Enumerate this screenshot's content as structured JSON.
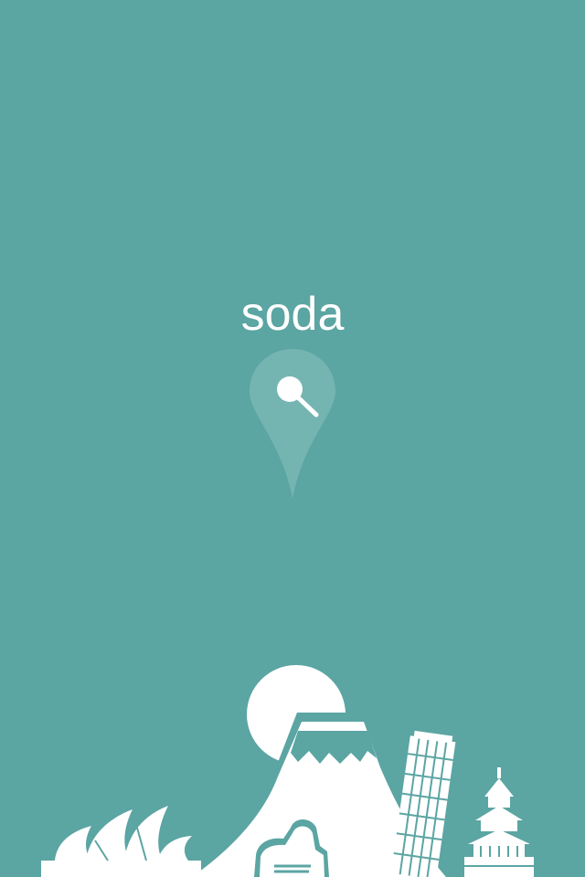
{
  "app": {
    "title": "soda"
  },
  "logo": {
    "pin_icon": "map-pin-icon",
    "search_icon": "search-icon"
  },
  "illustration": {
    "landmarks": [
      "sydney-opera-house-icon",
      "sun-icon",
      "mount-fuji-icon",
      "sphinx-icon",
      "leaning-tower-icon",
      "temple-of-heaven-icon"
    ]
  },
  "colors": {
    "background": "#5ba5a3",
    "foreground": "#ffffff",
    "pin": "#79b7b4"
  }
}
